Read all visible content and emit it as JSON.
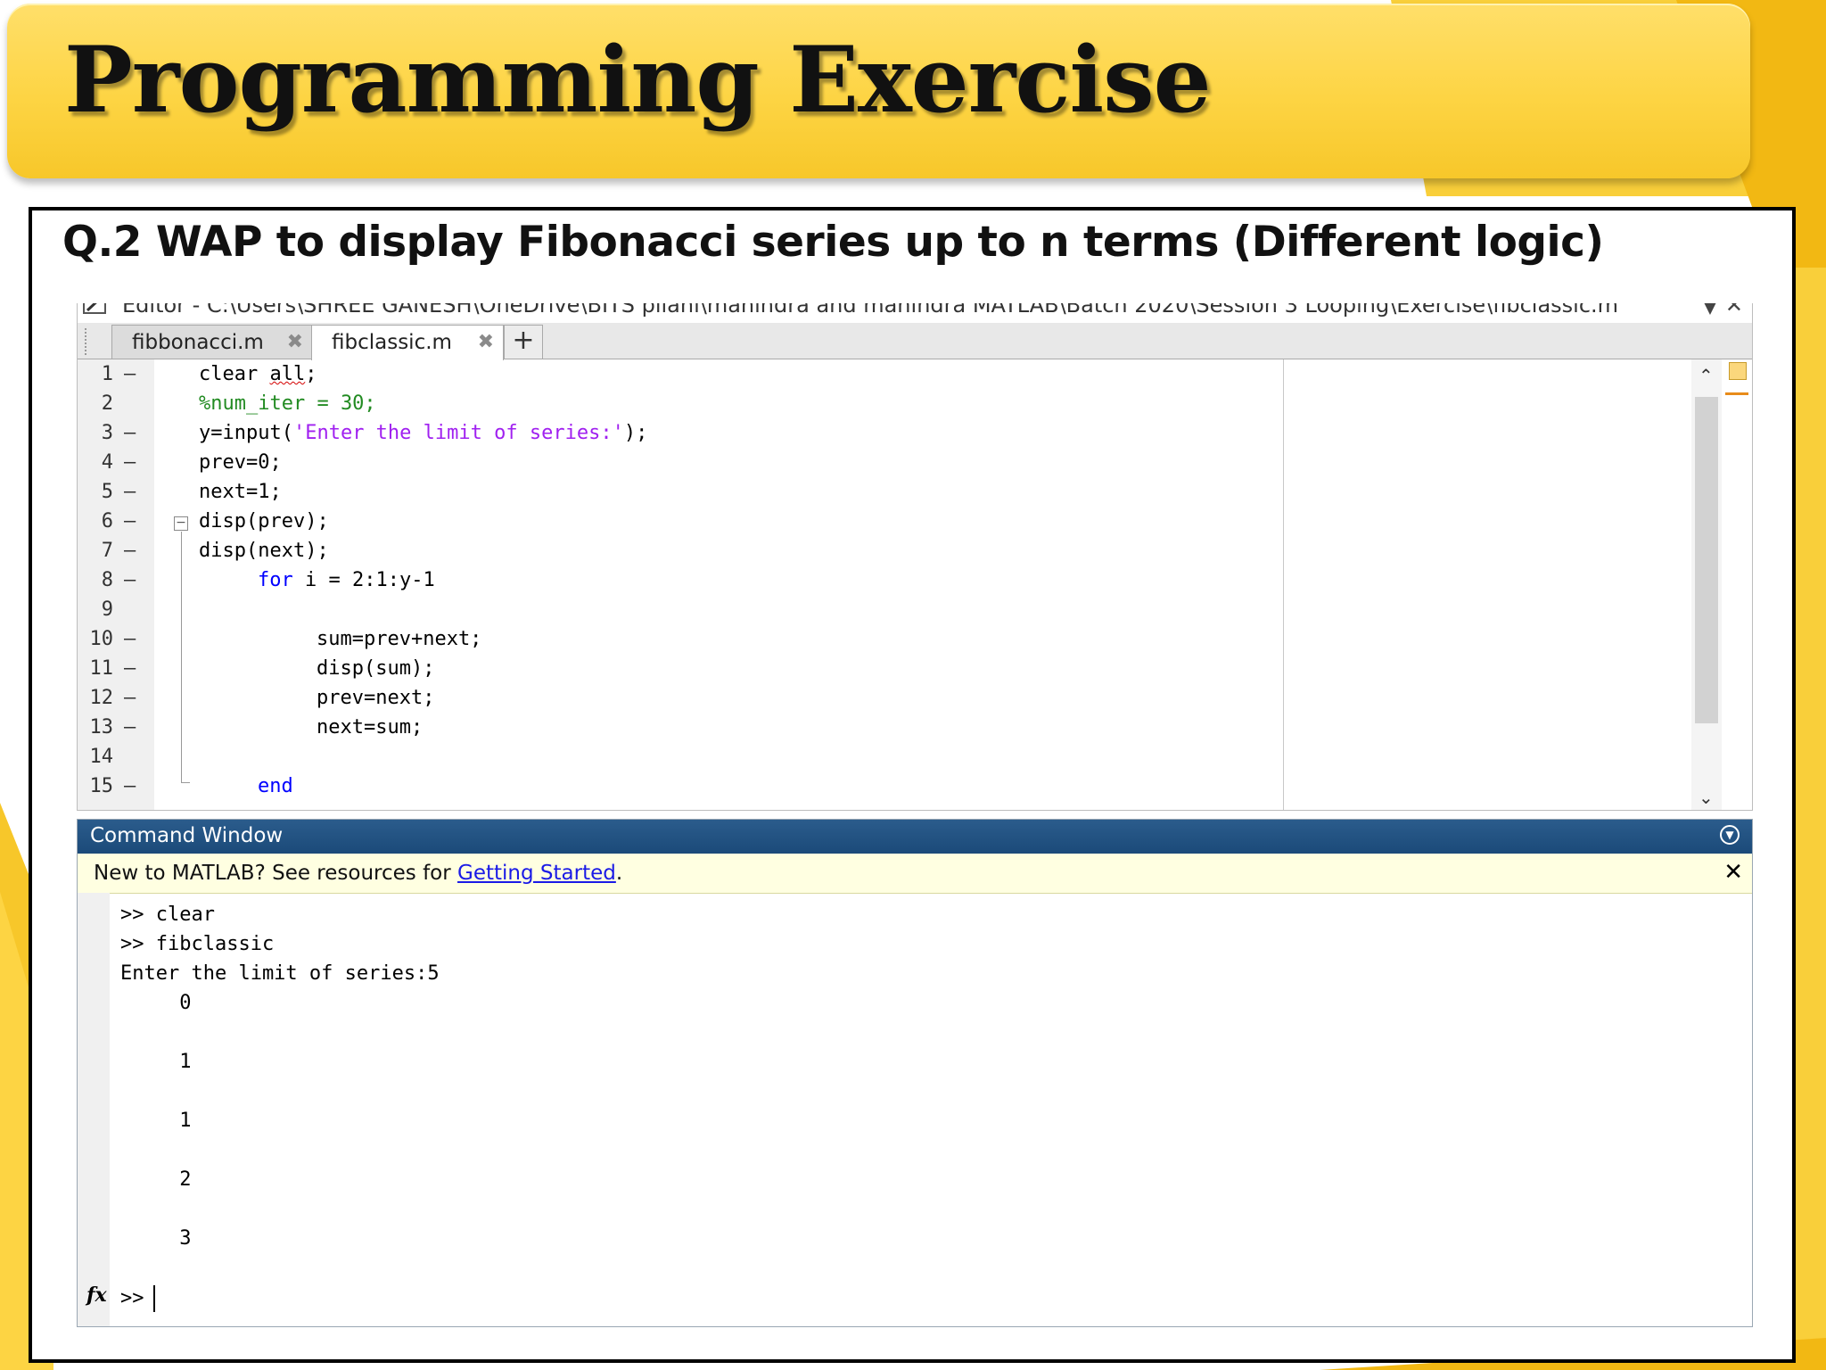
{
  "slide": {
    "title": "Programming Exercise",
    "question": "Q.2 WAP to display Fibonacci series up to n terms (Different  logic)"
  },
  "editor": {
    "path": "Editor - C:\\Users\\SHREE GANESH\\OneDrive\\BITS pilani\\mahindra and mahindra MATLAB\\Batch 2020\\Session 3 Looping\\Exercise\\fibclassic.m",
    "tabs": [
      {
        "label": "fibbonacci.m",
        "active": false
      },
      {
        "label": "fibclassic.m",
        "active": true
      }
    ],
    "add_tab_label": "+",
    "lines": [
      {
        "n": "1",
        "dash": "—",
        "indent": 0,
        "parts": [
          {
            "t": "clear ",
            "c": "plain"
          },
          {
            "t": "all",
            "c": "squig"
          },
          {
            "t": ";",
            "c": "plain"
          }
        ]
      },
      {
        "n": "2",
        "dash": "",
        "indent": 0,
        "parts": [
          {
            "t": "%num_iter = 30;",
            "c": "cmt"
          }
        ]
      },
      {
        "n": "3",
        "dash": "—",
        "indent": 0,
        "parts": [
          {
            "t": "y=input(",
            "c": "plain"
          },
          {
            "t": "'Enter the limit of series:'",
            "c": "str"
          },
          {
            "t": ");",
            "c": "plain"
          }
        ]
      },
      {
        "n": "4",
        "dash": "—",
        "indent": 0,
        "parts": [
          {
            "t": "prev=0;",
            "c": "plain"
          }
        ]
      },
      {
        "n": "5",
        "dash": "—",
        "indent": 0,
        "parts": [
          {
            "t": "next=1;",
            "c": "plain"
          }
        ]
      },
      {
        "n": "6",
        "dash": "—",
        "indent": 0,
        "parts": [
          {
            "t": "disp(prev);",
            "c": "plain"
          }
        ]
      },
      {
        "n": "7",
        "dash": "—",
        "indent": 0,
        "parts": [
          {
            "t": "disp(next);",
            "c": "plain"
          }
        ]
      },
      {
        "n": "8",
        "dash": "—",
        "indent": 1,
        "parts": [
          {
            "t": "for",
            "c": "kw"
          },
          {
            "t": " i = 2:1:y-1",
            "c": "plain"
          }
        ]
      },
      {
        "n": "9",
        "dash": "",
        "indent": 0,
        "parts": []
      },
      {
        "n": "10",
        "dash": "—",
        "indent": 2,
        "parts": [
          {
            "t": "sum=prev+next;",
            "c": "plain"
          }
        ]
      },
      {
        "n": "11",
        "dash": "—",
        "indent": 2,
        "parts": [
          {
            "t": "disp(sum);",
            "c": "plain"
          }
        ]
      },
      {
        "n": "12",
        "dash": "—",
        "indent": 2,
        "parts": [
          {
            "t": "prev=next;",
            "c": "plain"
          }
        ]
      },
      {
        "n": "13",
        "dash": "—",
        "indent": 2,
        "parts": [
          {
            "t": "next=sum;",
            "c": "plain"
          }
        ]
      },
      {
        "n": "14",
        "dash": "",
        "indent": 0,
        "parts": []
      },
      {
        "n": "15",
        "dash": "—",
        "indent": 1,
        "parts": [
          {
            "t": "end",
            "c": "kw"
          }
        ]
      }
    ]
  },
  "command_window": {
    "title": "Command Window",
    "notice_text": "New to MATLAB? See resources for ",
    "notice_link": "Getting Started",
    "notice_end": ".",
    "output": [
      ">> clear",
      ">> fibclassic",
      "Enter the limit of series:5",
      "     0",
      "",
      "     1",
      "",
      "     1",
      "",
      "     2",
      "",
      "     3"
    ],
    "fx_label": "fx",
    "prompt": ">>"
  }
}
